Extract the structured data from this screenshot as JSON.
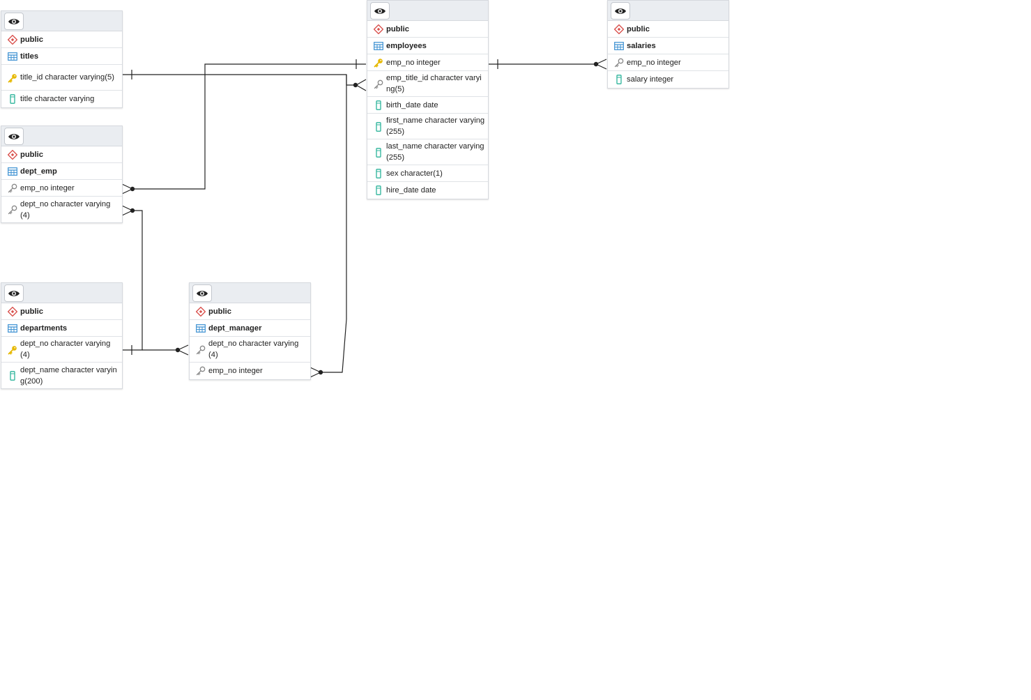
{
  "tables": [
    {
      "id": "titles",
      "schema": "public",
      "name": "titles",
      "columns": [
        {
          "text": "title_id character varying(5)",
          "icon": "primary-key-icon"
        },
        {
          "text": "title character varying",
          "icon": "column-icon"
        }
      ]
    },
    {
      "id": "dept_emp",
      "schema": "public",
      "name": "dept_emp",
      "columns": [
        {
          "text": "emp_no integer",
          "icon": "foreign-key-icon"
        },
        {
          "text": "dept_no character varying (4)",
          "icon": "foreign-key-icon"
        }
      ]
    },
    {
      "id": "departments",
      "schema": "public",
      "name": "departments",
      "columns": [
        {
          "text": "dept_no character varying (4)",
          "icon": "primary-key-icon"
        },
        {
          "text": "dept_name character varying(200)",
          "icon": "column-icon"
        }
      ]
    },
    {
      "id": "dept_manager",
      "schema": "public",
      "name": "dept_manager",
      "columns": [
        {
          "text": "dept_no character varying (4)",
          "icon": "foreign-key-icon"
        },
        {
          "text": "emp_no integer",
          "icon": "foreign-key-icon"
        }
      ]
    },
    {
      "id": "employees",
      "schema": "public",
      "name": "employees",
      "columns": [
        {
          "text": "emp_no integer",
          "icon": "primary-key-icon"
        },
        {
          "text": "emp_title_id character varying(5)",
          "icon": "foreign-key-icon"
        },
        {
          "text": "birth_date date",
          "icon": "column-icon"
        },
        {
          "text": "first_name character varying(255)",
          "icon": "column-icon"
        },
        {
          "text": "last_name character varying(255)",
          "icon": "column-icon"
        },
        {
          "text": "sex character(1)",
          "icon": "column-icon"
        },
        {
          "text": "hire_date date",
          "icon": "column-icon"
        }
      ]
    },
    {
      "id": "salaries",
      "schema": "public",
      "name": "salaries",
      "columns": [
        {
          "text": "emp_no integer",
          "icon": "foreign-key-icon"
        },
        {
          "text": "salary integer",
          "icon": "column-icon"
        }
      ]
    }
  ],
  "colors": {
    "schema_icon": "#d9534f",
    "table_icon": "#3a8fd1",
    "primary_key_icon": "#e6b800",
    "foreign_key_icon": "#888888",
    "column_icon": "#2bb39a",
    "link": "#222222"
  }
}
